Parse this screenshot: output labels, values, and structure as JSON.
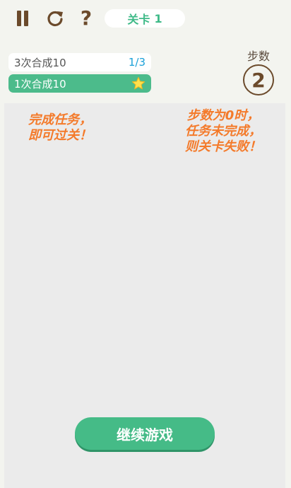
{
  "toolbar": {
    "pause_icon": "pause-icon",
    "restart_icon": "restart-icon",
    "help_glyph": "?"
  },
  "level": {
    "label": "关卡",
    "number": "1"
  },
  "tasks": [
    {
      "text": "3次合成10",
      "progress": "1/3",
      "completed": false
    },
    {
      "text": "1次合成10",
      "completed": true,
      "badge_icon": "star-icon"
    }
  ],
  "steps": {
    "label": "步数",
    "value": "2"
  },
  "hints": {
    "left": [
      "完成任务，",
      "即可过关！"
    ],
    "right": [
      "步数为0时，",
      "任务未完成，",
      "则关卡失败！"
    ]
  },
  "continue_button": {
    "label": "继续游戏"
  },
  "colors": {
    "background": "#f3f4ef",
    "board": "#ebebeb",
    "accent_green": "#45bb87",
    "hint_orange": "#f47a2a",
    "brown": "#6b4a2b",
    "progress_blue": "#1aa0d8"
  }
}
